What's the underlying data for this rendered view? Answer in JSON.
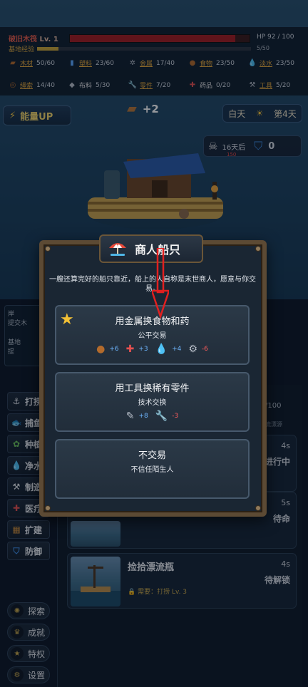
{
  "raft": {
    "name": "破旧木筏",
    "level": "Lv. 1",
    "hp_text": "HP 92 / 100",
    "hp_fraction": 0.92
  },
  "base_exp": {
    "label": "基地经验",
    "value": "5/50",
    "fraction": 0.1
  },
  "resources": [
    {
      "name": "木材",
      "value": "50/60",
      "icon": "wood-icon"
    },
    {
      "name": "塑料",
      "value": "23/60",
      "icon": "bottle-icon"
    },
    {
      "name": "金属",
      "value": "17/40",
      "icon": "gear-icon"
    },
    {
      "name": "食物",
      "value": "23/50",
      "icon": "food-icon"
    },
    {
      "name": "淡水",
      "value": "23/50",
      "icon": "water-icon"
    },
    {
      "name": "绳索",
      "value": "14/40",
      "icon": "rope-icon"
    },
    {
      "name": "布料",
      "value": "5/30",
      "icon": "cloth-icon"
    },
    {
      "name": "零件",
      "value": "7/20",
      "icon": "wrench-icon"
    },
    {
      "name": "药品",
      "value": "0/20",
      "icon": "medkit-icon"
    },
    {
      "name": "工具",
      "value": "5/20",
      "icon": "tool-icon"
    }
  ],
  "energy_button": "能量UP",
  "wood_gain": "+2",
  "time": {
    "period": "白天",
    "day": "第4天"
  },
  "threat": {
    "countdown": "16天后",
    "enemy_power": "150",
    "defense": "0"
  },
  "side_panel": {
    "line1": "岸",
    "line2": "提交木",
    "line3": "基地",
    "line4": "提"
  },
  "nav": [
    "打捞",
    "捕鱼",
    "种植",
    "净水",
    "制造",
    "医疗",
    "扩建",
    "防御"
  ],
  "bottom_nav": [
    "探索",
    "成就",
    "特权",
    "设置"
  ],
  "tasks": [
    {
      "title": "",
      "time": "4s",
      "state": "进行中"
    },
    {
      "title": "",
      "time": "5s",
      "state": "待命"
    },
    {
      "title": "捡拾漂流瓶",
      "time": "4s",
      "state": "待解锁",
      "requirement": "需要：打捞 Lv. 3"
    }
  ],
  "task_header": {
    "count": "/100",
    "tag": "流漂源"
  },
  "dialog": {
    "title": "商人船只",
    "description": "一艘还算完好的船只靠近，船上的人自称是末世商人，愿意与你交易。",
    "options": [
      {
        "title": "用金属换食物和药",
        "subtitle": "公平交易",
        "costs": [
          {
            "icon": "food-icon",
            "amount": "+6",
            "sign": "pos"
          },
          {
            "icon": "medkit-icon",
            "amount": "+3",
            "sign": "pos"
          },
          {
            "icon": "water-icon",
            "amount": "+4",
            "sign": "pos"
          },
          {
            "icon": "gear-icon",
            "amount": "-6",
            "sign": "neg"
          }
        ]
      },
      {
        "title": "用工具换稀有零件",
        "subtitle": "技术交换",
        "costs": [
          {
            "icon": "screw-icon",
            "amount": "+8",
            "sign": "pos"
          },
          {
            "icon": "wrench-icon",
            "amount": "-3",
            "sign": "neg"
          }
        ]
      },
      {
        "title": "不交易",
        "subtitle": "不信任陌生人",
        "costs": []
      }
    ]
  }
}
